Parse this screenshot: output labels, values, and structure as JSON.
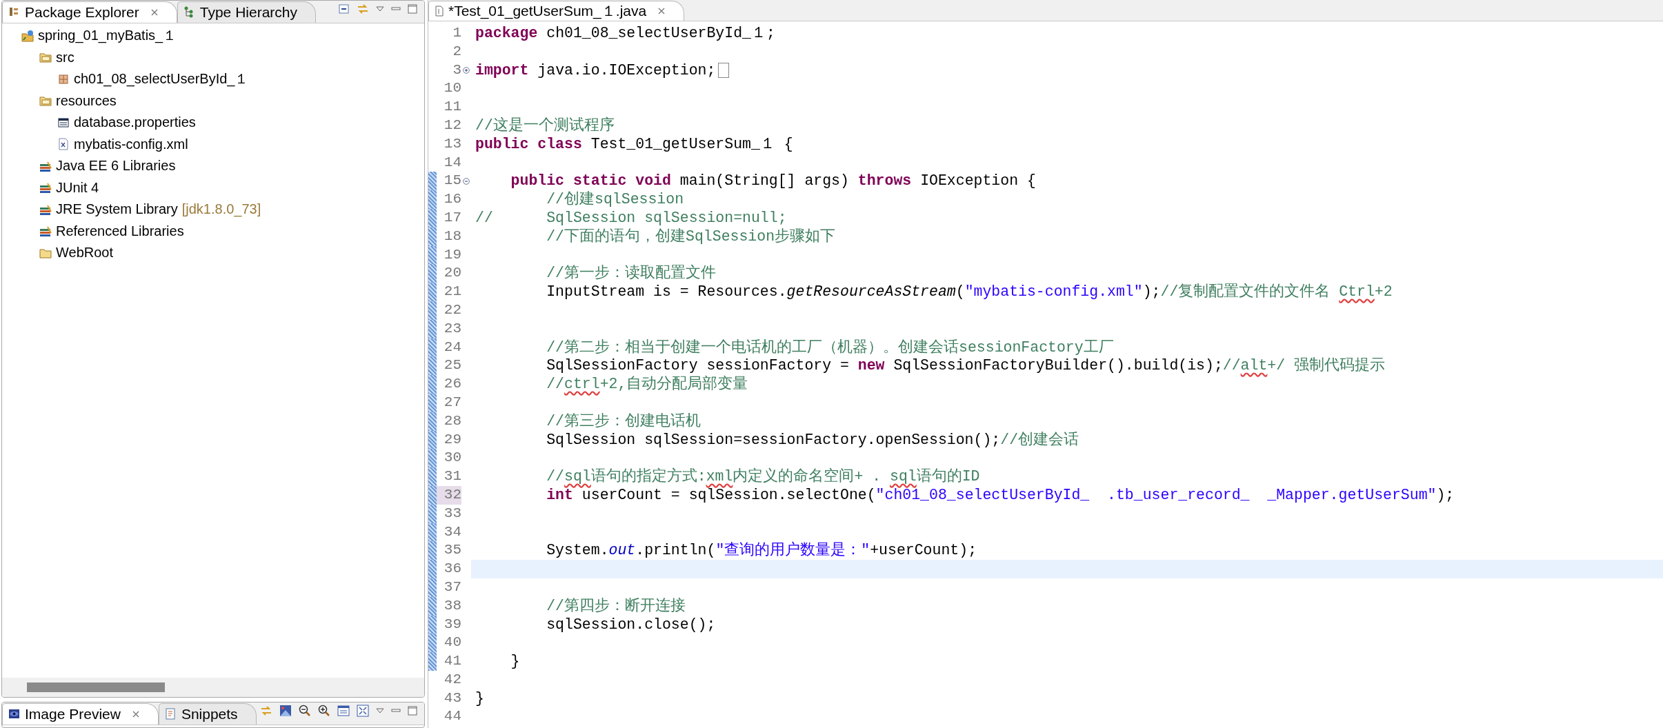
{
  "package_explorer": {
    "tabs": [
      {
        "label": "Package Explorer",
        "kind": "packages",
        "selected": true,
        "closable": true
      },
      {
        "label": "Type Hierarchy",
        "kind": "hierarchy",
        "selected": false,
        "closable": false
      }
    ],
    "tree": [
      {
        "label": "spring_01_myBatis_１",
        "kind": "project",
        "children": [
          {
            "label": "src",
            "kind": "source-folder",
            "children": [
              {
                "label": "ch01_08_selectUserById_１",
                "kind": "package"
              }
            ]
          },
          {
            "label": "resources",
            "kind": "source-folder",
            "children": [
              {
                "label": "database.properties",
                "kind": "properties-file"
              },
              {
                "label": "mybatis-config.xml",
                "kind": "xml-file"
              }
            ]
          },
          {
            "label": "Java EE 6 Libraries",
            "kind": "library"
          },
          {
            "label": "JUnit 4",
            "kind": "library"
          },
          {
            "label": "JRE System Library",
            "detail": "[jdk1.8.0_73]",
            "kind": "library"
          },
          {
            "label": "Referenced Libraries",
            "kind": "library"
          },
          {
            "label": "WebRoot",
            "kind": "folder"
          }
        ]
      }
    ]
  },
  "editor": {
    "tabs": [
      {
        "label": "*Test_01_getUserSum_１.java",
        "selected": true,
        "closable": true
      }
    ],
    "lines": [
      {
        "number": "1",
        "current": false,
        "changed": false,
        "marked": false,
        "tokens": [
          {
            "kind": "keyword",
            "text": "package"
          },
          {
            "kind": "plain",
            "text": " ch01_08_selectUserById_１;"
          }
        ]
      },
      {
        "number": "2",
        "current": false,
        "changed": false,
        "marked": false
      },
      {
        "number": "3",
        "current": false,
        "changed": false,
        "marked": false,
        "fold": {
          "collapsed": true
        },
        "tokens": [
          {
            "kind": "keyword",
            "text": "import"
          },
          {
            "kind": "plain",
            "text": " java.io.IOException;"
          }
        ]
      },
      {
        "number": "10",
        "current": false,
        "changed": false,
        "marked": false
      },
      {
        "number": "11",
        "current": false,
        "changed": false,
        "marked": false
      },
      {
        "number": "12",
        "current": false,
        "changed": false,
        "marked": false,
        "tokens": [
          {
            "kind": "comment",
            "text": "//这是一个测试程序"
          }
        ]
      },
      {
        "number": "13",
        "current": false,
        "changed": false,
        "marked": false,
        "tokens": [
          {
            "kind": "keyword",
            "text": "public class"
          },
          {
            "kind": "plain",
            "text": " Test_01_getUserSum_１ {"
          }
        ]
      },
      {
        "number": "14",
        "current": false,
        "changed": false,
        "marked": false
      },
      {
        "number": "15",
        "current": false,
        "changed": true,
        "marked": false,
        "fold": {
          "collapsed": false
        },
        "tokens": [
          {
            "kind": "keyword",
            "text": "    public static void"
          },
          {
            "kind": "plain",
            "text": " main(String[] args) "
          },
          {
            "kind": "keyword",
            "text": "throws"
          },
          {
            "kind": "plain",
            "text": " IOException {"
          }
        ]
      },
      {
        "number": "16",
        "current": false,
        "changed": true,
        "marked": false,
        "tokens": [
          {
            "kind": "comment",
            "text": "        //创建sqlSession"
          }
        ]
      },
      {
        "number": "17",
        "current": false,
        "changed": true,
        "marked": false,
        "tokens": [
          {
            "kind": "comment",
            "text": "//      SqlSession sqlSession=null;"
          }
        ]
      },
      {
        "number": "18",
        "current": false,
        "changed": true,
        "marked": false,
        "tokens": [
          {
            "kind": "comment",
            "text": "        //下面的语句，创建SqlSession步骤如下"
          }
        ]
      },
      {
        "number": "19",
        "current": false,
        "changed": true,
        "marked": false
      },
      {
        "number": "20",
        "current": false,
        "changed": true,
        "marked": false,
        "tokens": [
          {
            "kind": "comment",
            "text": "        //第一步：读取配置文件"
          }
        ]
      },
      {
        "number": "21",
        "current": false,
        "changed": true,
        "marked": false,
        "tokens": [
          {
            "kind": "plain",
            "text": "        InputStream is = Resources."
          },
          {
            "kind": "static-call",
            "text": "getResourceAsStream"
          },
          {
            "kind": "plain",
            "text": "("
          },
          {
            "kind": "string",
            "text": "\"mybatis-config.xml\""
          },
          {
            "kind": "plain",
            "text": ");"
          },
          {
            "kind": "comment",
            "text": "//复制配置文件的文件名 "
          },
          {
            "kind": "typo",
            "text": "Ctrl"
          },
          {
            "kind": "comment",
            "text": "+2"
          }
        ]
      },
      {
        "number": "22",
        "current": false,
        "changed": true,
        "marked": false
      },
      {
        "number": "23",
        "current": false,
        "changed": true,
        "marked": false
      },
      {
        "number": "24",
        "current": false,
        "changed": true,
        "marked": false,
        "tokens": [
          {
            "kind": "comment",
            "text": "        //第二步：相当于创建一个电话机的工厂（机器）。创建会话sessionFactory工厂"
          }
        ]
      },
      {
        "number": "25",
        "current": false,
        "changed": true,
        "marked": false,
        "tokens": [
          {
            "kind": "plain",
            "text": "        SqlSessionFactory sessionFactory = "
          },
          {
            "kind": "keyword",
            "text": "new"
          },
          {
            "kind": "plain",
            "text": " SqlSessionFactoryBuilder().build(is);"
          },
          {
            "kind": "comment",
            "text": "//"
          },
          {
            "kind": "typo",
            "text": "alt"
          },
          {
            "kind": "comment",
            "text": "+/ 强制代码提示"
          }
        ]
      },
      {
        "number": "26",
        "current": false,
        "changed": true,
        "marked": false,
        "tokens": [
          {
            "kind": "comment",
            "text": "        //"
          },
          {
            "kind": "typo",
            "text": "ctrl"
          },
          {
            "kind": "comment",
            "text": "+2,自动分配局部变量"
          }
        ]
      },
      {
        "number": "27",
        "current": false,
        "changed": true,
        "marked": false
      },
      {
        "number": "28",
        "current": false,
        "changed": true,
        "marked": false,
        "tokens": [
          {
            "kind": "comment",
            "text": "        //第三步：创建电话机"
          }
        ]
      },
      {
        "number": "29",
        "current": false,
        "changed": true,
        "marked": false,
        "tokens": [
          {
            "kind": "plain",
            "text": "        SqlSession sqlSession=sessionFactory.openSession();"
          },
          {
            "kind": "comment",
            "text": "//创建会话"
          }
        ]
      },
      {
        "number": "30",
        "current": false,
        "changed": true,
        "marked": false
      },
      {
        "number": "31",
        "current": false,
        "changed": true,
        "marked": false,
        "tokens": [
          {
            "kind": "comment",
            "text": "        //"
          },
          {
            "kind": "typo",
            "text": "sql"
          },
          {
            "kind": "comment",
            "text": "语句的指定方式:"
          },
          {
            "kind": "typo",
            "text": "xml"
          },
          {
            "kind": "comment",
            "text": "内定义的命名空间+ . "
          },
          {
            "kind": "typo",
            "text": "sql"
          },
          {
            "kind": "comment",
            "text": "语句的ID"
          }
        ]
      },
      {
        "number": "32",
        "current": false,
        "changed": true,
        "marked": true,
        "tokens": [
          {
            "kind": "keyword",
            "text": "        int"
          },
          {
            "kind": "plain",
            "text": " userCount = sqlSession.selectOne("
          },
          {
            "kind": "string",
            "text": "\"ch01_08_selectUserById_  .tb_user_record_  _Mapper.getUserSum\""
          },
          {
            "kind": "plain",
            "text": ");"
          }
        ]
      },
      {
        "number": "33",
        "current": false,
        "changed": true,
        "marked": false
      },
      {
        "number": "34",
        "current": false,
        "changed": true,
        "marked": false
      },
      {
        "number": "35",
        "current": false,
        "changed": true,
        "marked": false,
        "tokens": [
          {
            "kind": "plain",
            "text": "        System."
          },
          {
            "kind": "field",
            "text": "out"
          },
          {
            "kind": "plain",
            "text": ".println("
          },
          {
            "kind": "string",
            "text": "\"查询的用户数量是：\""
          },
          {
            "kind": "plain",
            "text": "+userCount);"
          }
        ]
      },
      {
        "number": "36",
        "current": true,
        "changed": true,
        "marked": false
      },
      {
        "number": "37",
        "current": false,
        "changed": true,
        "marked": false
      },
      {
        "number": "38",
        "current": false,
        "changed": true,
        "marked": false,
        "tokens": [
          {
            "kind": "comment",
            "text": "        //第四步：断开连接"
          }
        ]
      },
      {
        "number": "39",
        "current": false,
        "changed": true,
        "marked": false,
        "tokens": [
          {
            "kind": "plain",
            "text": "        sqlSession.close();"
          }
        ]
      },
      {
        "number": "40",
        "current": false,
        "changed": true,
        "marked": false
      },
      {
        "number": "41",
        "current": false,
        "changed": true,
        "marked": false,
        "tokens": [
          {
            "kind": "plain",
            "text": "    }"
          }
        ]
      },
      {
        "number": "42",
        "current": false,
        "changed": false,
        "marked": false
      },
      {
        "number": "43",
        "current": false,
        "changed": false,
        "marked": false,
        "tokens": [
          {
            "kind": "plain",
            "text": "}"
          }
        ]
      },
      {
        "number": "44",
        "current": false,
        "changed": false,
        "marked": false
      }
    ]
  },
  "bottom_view": {
    "tabs": [
      {
        "label": "Image Preview",
        "kind": "image",
        "selected": true,
        "closable": true
      },
      {
        "label": "Snippets",
        "kind": "snippets",
        "selected": false,
        "closable": false
      }
    ]
  }
}
